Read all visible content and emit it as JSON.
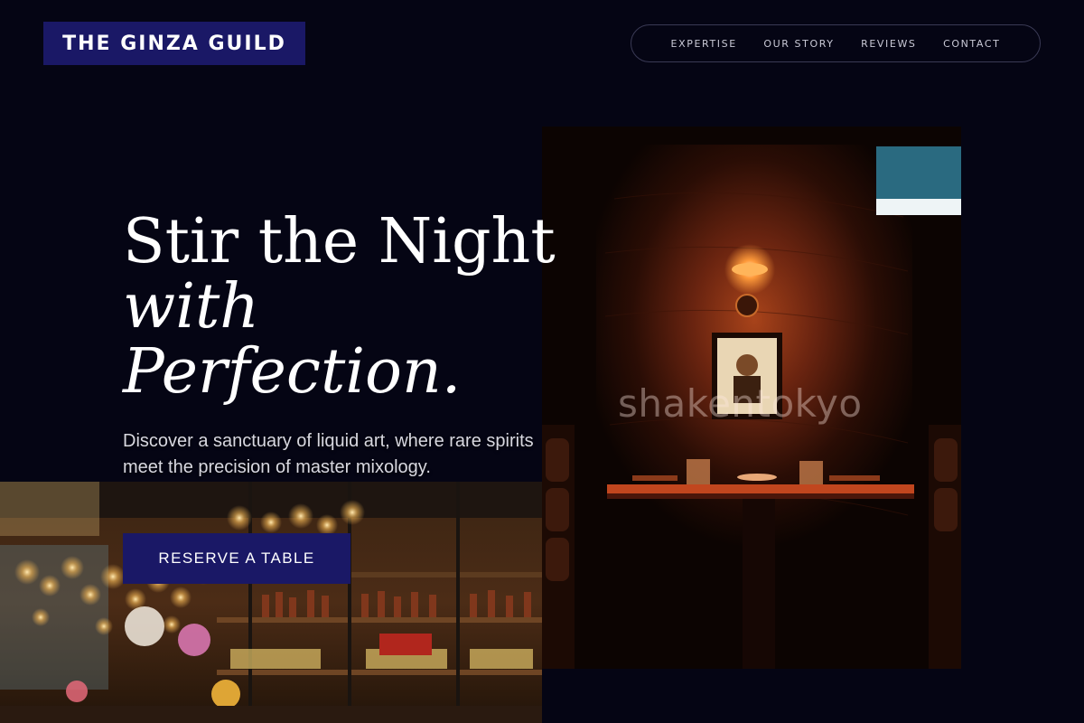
{
  "header": {
    "brand": "THE GINZA GUILD",
    "nav": [
      {
        "label": "EXPERTISE"
      },
      {
        "label": "OUR STORY"
      },
      {
        "label": "REVIEWS"
      },
      {
        "label": "CONTACT"
      }
    ]
  },
  "hero": {
    "title_line1": "Stir the Night",
    "title_line2": "with",
    "title_line3": "Perfection.",
    "subtitle": "Discover a sanctuary of liquid art, where rare spirits meet the precision of master mixology.",
    "cta_label": "RESERVE A TABLE"
  },
  "images": {
    "booth_watermark": "shakentokyo"
  },
  "colors": {
    "background": "#050514",
    "brand_navy": "#1a1866",
    "text": "#ffffff",
    "nav_text": "#c9c9d6"
  }
}
